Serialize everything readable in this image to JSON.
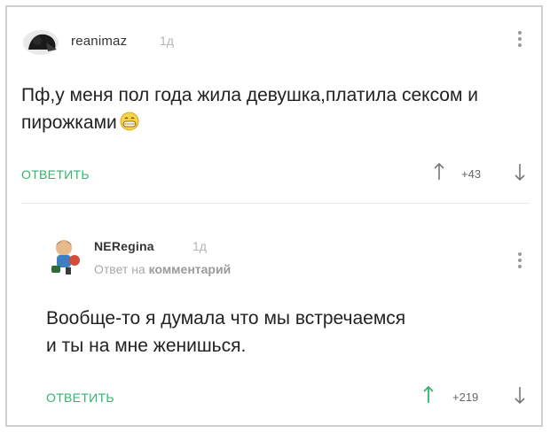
{
  "colors": {
    "accent": "#31b66b",
    "text": "#222222",
    "muted": "#a8a8a8"
  },
  "comment1": {
    "username": "reanimaz",
    "time": "1д",
    "text": "Пф,у меня пол года жила девушка,платила сексом и пирожками",
    "emoji_icon": "grinning-face-icon",
    "reply_label": "ОТВЕТИТЬ",
    "rating": "+43"
  },
  "comment2": {
    "username": "NERegina",
    "time": "1д",
    "reply_prefix": "Ответ на",
    "reply_target": "комментарий",
    "text_line1": "Вообще-то я думала что мы встречаемся",
    "text_line2": "и ты на мне женишься.",
    "reply_label": "ОТВЕТИТЬ",
    "rating": "+219"
  }
}
